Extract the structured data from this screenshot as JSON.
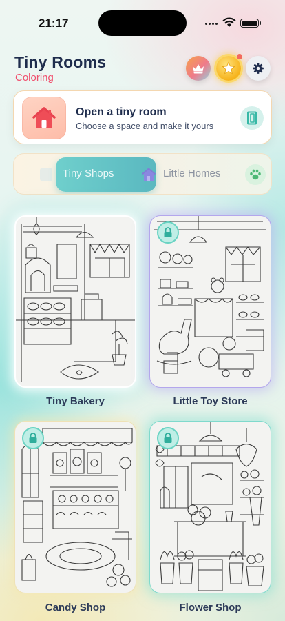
{
  "status_bar": {
    "time": "21:17"
  },
  "header": {
    "title": "Tiny Rooms",
    "subtitle": "Coloring"
  },
  "header_icons": [
    "crown-icon",
    "star-icon",
    "gear-icon"
  ],
  "open_room_card": {
    "title": "Open a tiny room",
    "subtitle": "Choose a space and make it yours",
    "icon": "house-icon",
    "action_icon": "door-icon"
  },
  "categories": {
    "active": "Tiny Shops",
    "items": [
      {
        "label": "Tiny Shops",
        "icon": "shop-icon",
        "selected": true
      },
      {
        "label": "Little Homes",
        "icon": "house-icon",
        "selected": false
      },
      {
        "label": "",
        "icon": "paw-icon",
        "selected": false
      }
    ]
  },
  "rooms": [
    {
      "title": "Tiny Bakery",
      "locked": false
    },
    {
      "title": "Little Toy Store",
      "locked": true
    },
    {
      "title": "Candy Shop",
      "locked": true
    },
    {
      "title": "Flower Shop",
      "locked": true
    }
  ],
  "colors": {
    "accent_teal": "#5ab8c0",
    "subtitle_pink": "#f0506e",
    "title_navy": "#1f2d4d",
    "lock_teal": "#6ad3c3"
  }
}
